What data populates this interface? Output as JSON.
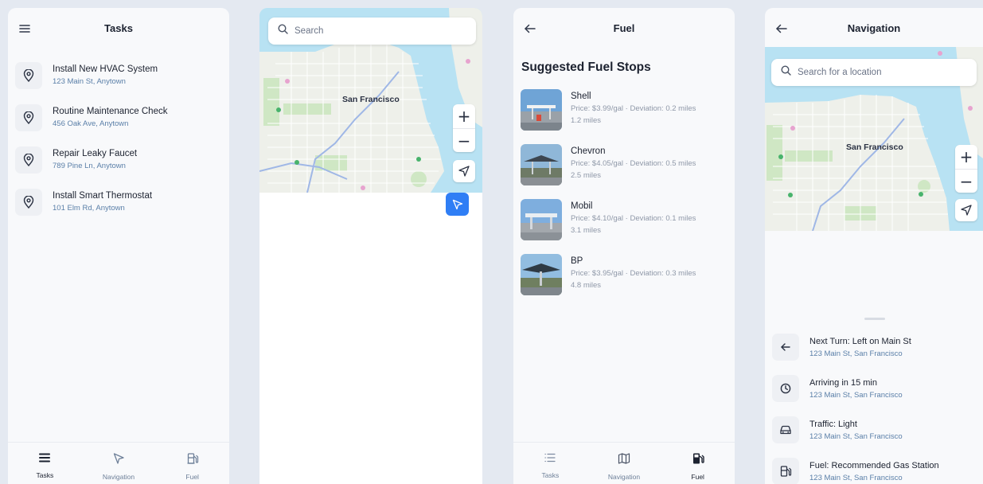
{
  "tasks_screen": {
    "title": "Tasks",
    "items": [
      {
        "title": "Install New HVAC System",
        "address": "123 Main St, Anytown"
      },
      {
        "title": "Routine Maintenance Check",
        "address": "456 Oak Ave, Anytown"
      },
      {
        "title": "Repair Leaky Faucet",
        "address": "789 Pine Ln, Anytown"
      },
      {
        "title": "Install Smart Thermostat",
        "address": "101 Elm Rd, Anytown"
      }
    ],
    "tabs": [
      {
        "label": "Tasks",
        "icon": "list-icon",
        "active": true
      },
      {
        "label": "Navigation",
        "icon": "navigation-arrow-icon",
        "active": false
      },
      {
        "label": "Fuel",
        "icon": "fuel-pump-icon",
        "active": false
      }
    ]
  },
  "map_screen": {
    "search_placeholder": "Search",
    "city_label": "San Francisco"
  },
  "fuel_screen": {
    "title": "Fuel",
    "heading": "Suggested Fuel Stops",
    "stations": [
      {
        "name": "Shell",
        "details": "Price: $3.99/gal · Deviation: 0.2 miles",
        "distance": "1.2 miles"
      },
      {
        "name": "Chevron",
        "details": "Price: $4.05/gal · Deviation: 0.5 miles",
        "distance": "2.5 miles"
      },
      {
        "name": "Mobil",
        "details": "Price: $4.10/gal · Deviation: 0.1 miles",
        "distance": "3.1 miles"
      },
      {
        "name": "BP",
        "details": "Price: $3.95/gal · Deviation: 0.3 miles",
        "distance": "4.8 miles"
      }
    ],
    "tabs": [
      {
        "label": "Tasks",
        "icon": "list-icon",
        "active": false
      },
      {
        "label": "Navigation",
        "icon": "map-icon",
        "active": false
      },
      {
        "label": "Fuel",
        "icon": "fuel-pump-icon",
        "active": true
      }
    ]
  },
  "navigation_screen": {
    "title": "Navigation",
    "search_placeholder": "Search for a location",
    "city_label": "San Francisco",
    "items": [
      {
        "title": "Next Turn: Left on Main St",
        "address": "123 Main St, San Francisco",
        "icon": "arrow-left-icon"
      },
      {
        "title": "Arriving in 15 min",
        "address": "123 Main St, San Francisco",
        "icon": "clock-icon"
      },
      {
        "title": "Traffic: Light",
        "address": "123 Main St, San Francisco",
        "icon": "car-icon"
      },
      {
        "title": "Fuel: Recommended Gas Station",
        "address": "123 Main St, San Francisco",
        "icon": "fuel-pump-icon"
      }
    ]
  },
  "colors": {
    "accent_blue": "#2f7ef5",
    "map_water": "#b8e2f3",
    "map_land": "#eef0ea",
    "park_green": "#cfe7c4",
    "subtitle_blue": "#5a7fa8"
  }
}
